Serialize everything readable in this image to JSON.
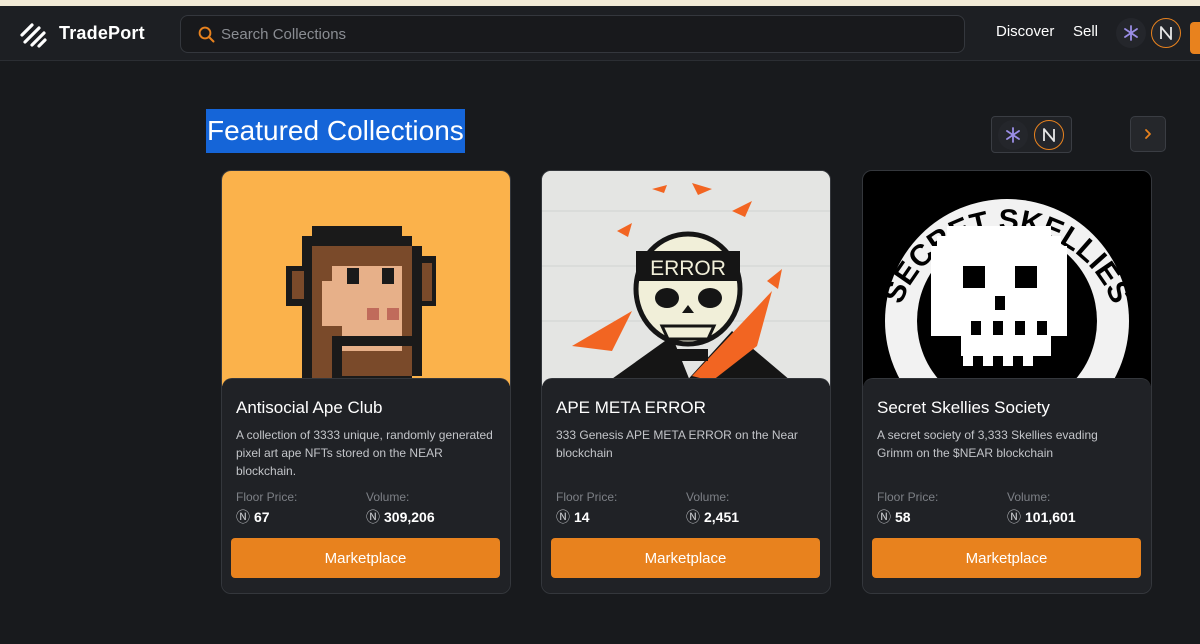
{
  "nav": {
    "brand": "TradePort",
    "search_placeholder": "Search Collections",
    "links": [
      "Discover",
      "Sell"
    ],
    "chain_icons": [
      "starknet-icon",
      "near-icon"
    ]
  },
  "featured": {
    "title": "Featured Collections",
    "chain_icons": [
      "starknet-icon",
      "near-icon"
    ],
    "next_icon": "chevron-right-icon"
  },
  "currency_symbol": "Ⓝ",
  "collections": [
    {
      "name": "Antisocial Ape Club",
      "description": "A collection of 3333 unique, randomly generated pixel art ape NFTs stored on the NEAR blockchain.",
      "floor_label": "Floor Price:",
      "floor": "67",
      "volume_label": "Volume:",
      "volume": "309,206",
      "button": "Marketplace"
    },
    {
      "name": "APE META ERROR",
      "description": "333 Genesis APE META ERROR on the Near blockchain",
      "image_text": "ERROR",
      "floor_label": "Floor Price:",
      "floor": "14",
      "volume_label": "Volume:",
      "volume": "2,451",
      "button": "Marketplace"
    },
    {
      "name": "Secret Skellies Society",
      "description": "A secret society of 3,333 Skellies evading Grimm on the $NEAR blockchain",
      "image_text": "SECRET SKELLIES",
      "floor_label": "Floor Price:",
      "floor": "58",
      "volume_label": "Volume:",
      "volume": "101,601",
      "button": "Marketplace"
    }
  ],
  "colors": {
    "accent": "#e8821e",
    "background": "#181a1d",
    "card": "#202226",
    "highlight": "#1565d8"
  }
}
